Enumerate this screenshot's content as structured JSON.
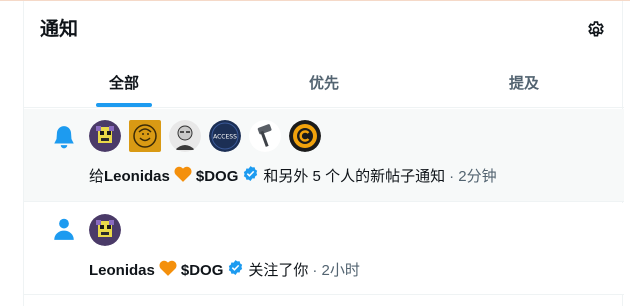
{
  "header": {
    "title": "通知",
    "settings_icon": "gear-icon"
  },
  "tabs": [
    {
      "label": "全部",
      "active": true
    },
    {
      "label": "优先",
      "active": false
    },
    {
      "label": "提及",
      "active": false
    }
  ],
  "notifications": [
    {
      "kind_icon": "bell-icon",
      "avatars": [
        "pixel-dog-avatar",
        "gold-lion-avatar",
        "sketch-man-avatar",
        "access-avatar",
        "gavel-avatar",
        "gold-coin-avatar"
      ],
      "prefix": "给 ",
      "name": "Leonidas",
      "emoji": "orange-heart-icon",
      "ticker": "$DOG",
      "verified": true,
      "text": "和另外 5 个人的新帖子通知",
      "time": "· 2分钟"
    },
    {
      "kind_icon": "person-icon",
      "avatars": [
        "pixel-dog-avatar"
      ],
      "prefix": "",
      "name": "Leonidas",
      "emoji": "orange-heart-icon",
      "ticker": "$DOG",
      "verified": true,
      "text": "关注了你",
      "time": "· 2小时"
    }
  ],
  "colors": {
    "accent": "#1d9bf0",
    "heart": "#f4900c",
    "muted": "#536471"
  },
  "avatar_labels": {
    "access": "ACCESS"
  }
}
